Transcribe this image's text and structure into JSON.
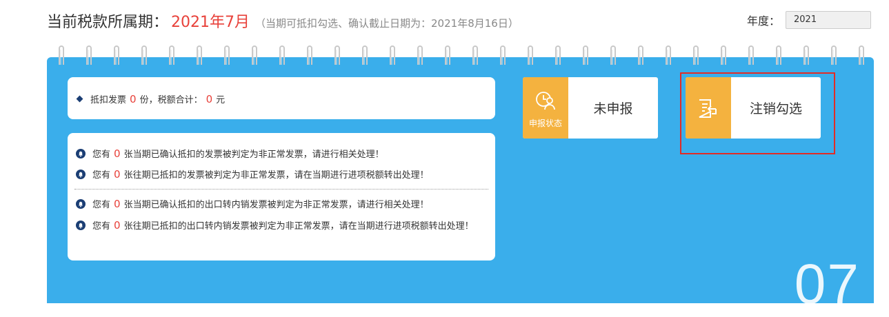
{
  "header": {
    "title_label": "当前税款所属期：",
    "period": "2021年7月",
    "note": "（当期可抵扣勾选、确认截止日期为：2021年8月16日）"
  },
  "year": {
    "label": "年度：",
    "value": "2021"
  },
  "summary": {
    "prefix": "抵扣发票",
    "invoice_count": "0",
    "mid": "份，税额合计：",
    "tax_total": "0",
    "suffix": "元"
  },
  "alerts": [
    {
      "prefix": "您有",
      "count": "0",
      "text": "张当期已确认抵扣的发票被判定为非正常发票，请进行相关处理！"
    },
    {
      "prefix": "您有",
      "count": "0",
      "text": "张往期已抵扣的发票被判定为非正常发票，请在当期进行进项税额转出处理！"
    },
    {
      "prefix": "您有",
      "count": "0",
      "text": "张当期已确认抵扣的出口转内销发票被判定为非正常发票，请进行相关处理！"
    },
    {
      "prefix": "您有",
      "count": "0",
      "text": "张往期已抵扣的出口转内销发票被判定为非正常发票，请在当期进行进项税额转出处理！"
    }
  ],
  "status_tile": {
    "icon_label": "申报状态",
    "value": "未申报"
  },
  "cancel_tile": {
    "label": "注销勾选"
  },
  "month_number": "07",
  "colors": {
    "calendar": "#3aaeeb",
    "accent": "#f4b23f",
    "alert_red": "#e8413a",
    "highlight": "#e32b25"
  },
  "icons": {
    "summary_bullet": "diamond-icon",
    "alert_bell": "bell-icon",
    "status": "clock-person-icon",
    "cancel": "document-return-icon"
  }
}
